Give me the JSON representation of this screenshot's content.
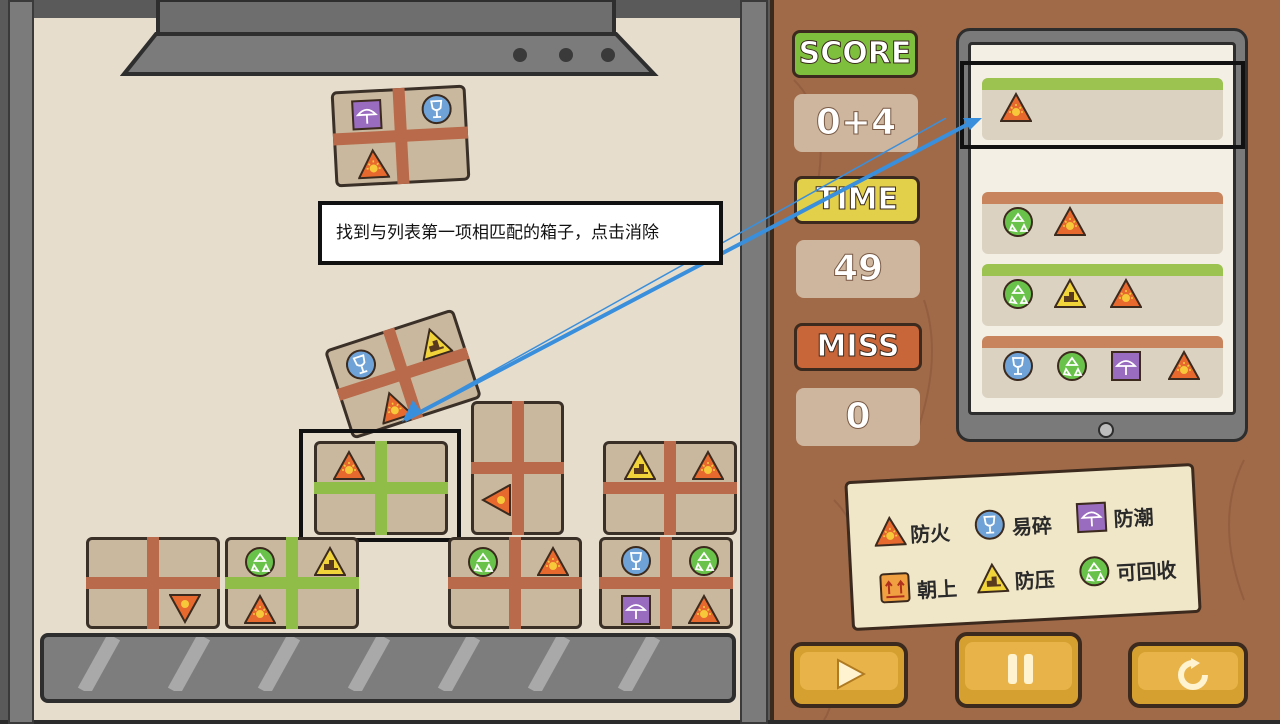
{
  "hud": {
    "score_label": "SCORE",
    "score_value": "0+4",
    "time_label": "TIME",
    "time_value": "49",
    "miss_label": "MISS",
    "miss_value": "0"
  },
  "tooltip": {
    "text": "找到与列表第一项相匹配的箱子，点击消除"
  },
  "order_list": [
    {
      "bar_color": "#9cc34f",
      "icons": [
        "fire-proof-icon"
      ]
    },
    {
      "bar_color": "#c8855d",
      "icons": [
        "recyclable-icon",
        "fire-proof-icon"
      ]
    },
    {
      "bar_color": "#9cc34f",
      "icons": [
        "recyclable-icon",
        "pressure-proof-icon",
        "fire-proof-icon"
      ]
    },
    {
      "bar_color": "#c8855d",
      "icons": [
        "fragile-icon",
        "recyclable-icon",
        "moisture-proof-icon",
        "fire-proof-icon"
      ]
    }
  ],
  "legend": {
    "fire": "防火",
    "fragile": "易碎",
    "moisture": "防潮",
    "up": "朝上",
    "pressure": "防压",
    "recycle": "可回收"
  },
  "colors": {
    "panel_wood": "#a06a48",
    "score_green": "#7ec03e",
    "time_yellow": "#e2cf4a",
    "miss_orange": "#c8663a",
    "tape_brown": "#b86a4a",
    "tape_green": "#8fbd47",
    "arrow_blue": "#3a8fdc"
  },
  "controls": [
    "play-button",
    "pause-button",
    "restart-button"
  ]
}
